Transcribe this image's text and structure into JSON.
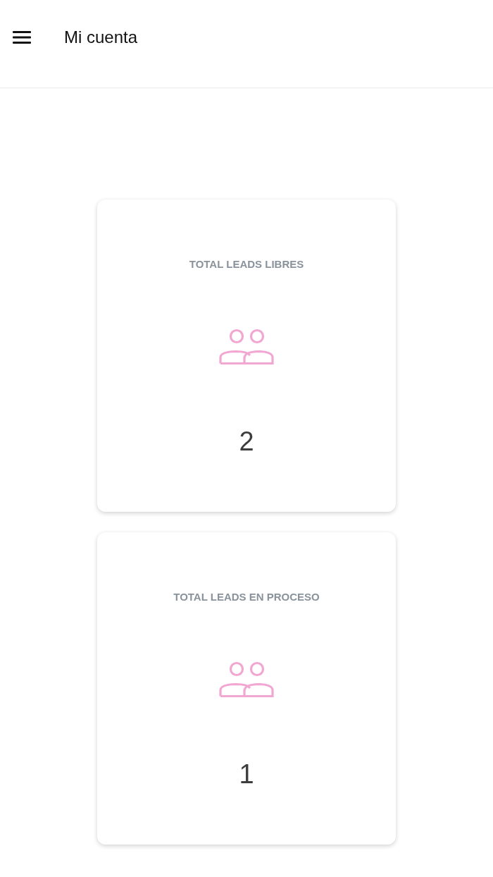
{
  "app_bar": {
    "title": "Mi cuenta"
  },
  "cards": [
    {
      "title": "TOTAL LEADS LIBRES",
      "value": "2"
    },
    {
      "title": "TOTAL LEADS EN PROCESO",
      "value": "1"
    }
  ]
}
